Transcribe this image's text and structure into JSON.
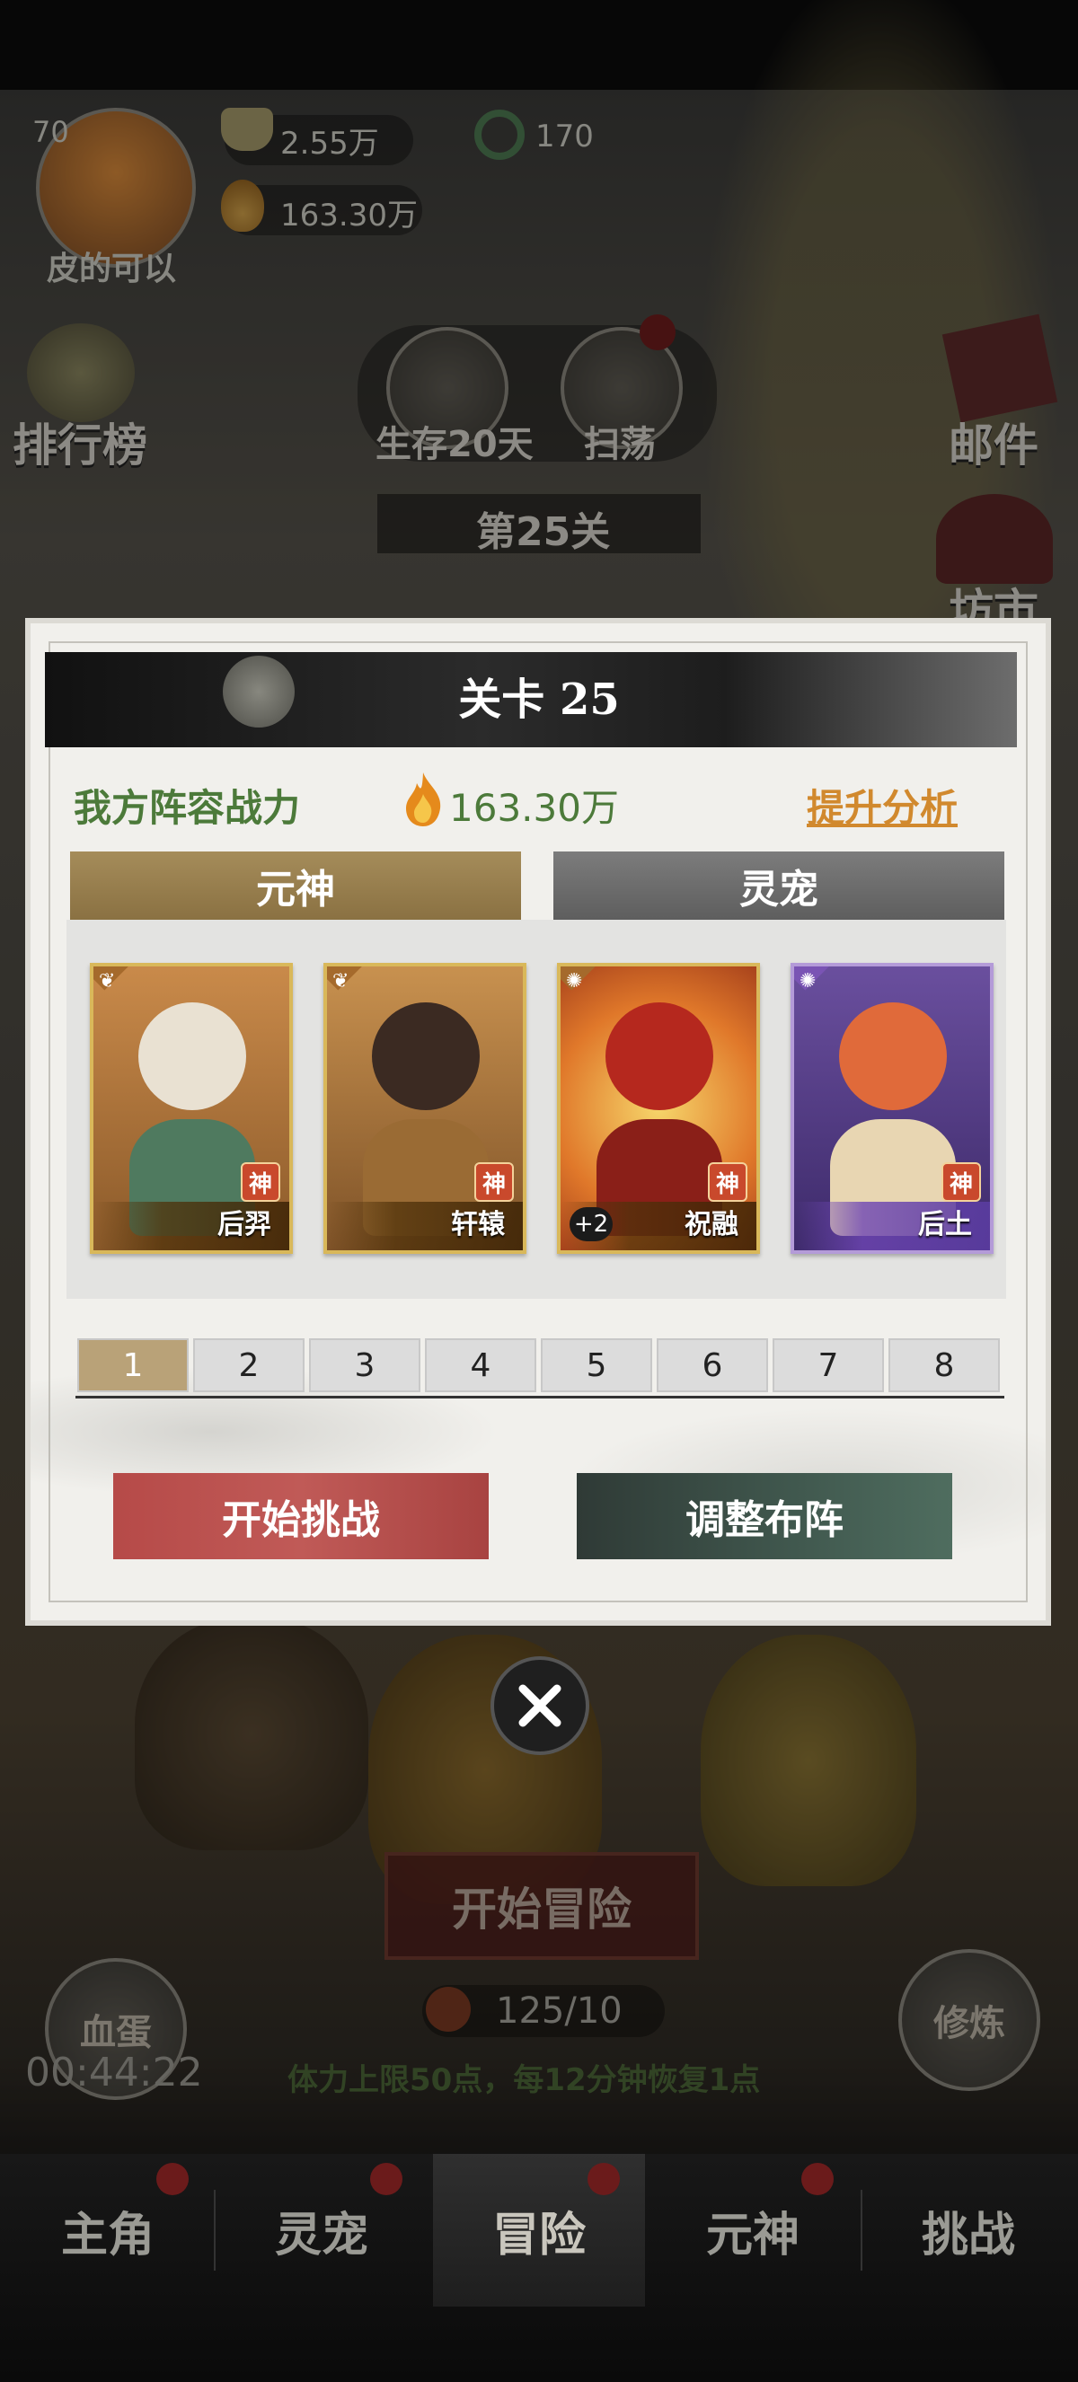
{
  "hud": {
    "level": "70",
    "player_name": "皮的可以",
    "gold": "2.55万",
    "jade": "170",
    "power": "163.30万"
  },
  "scene": {
    "ranking_label": "排行榜",
    "mail_label": "邮件",
    "market_label": "坊市",
    "survive_label": "生存20天",
    "sweep_label": "扫荡",
    "stage_label": "第25关",
    "adventure_button": "开始冒险",
    "blood_egg_label": "血蛋",
    "timer": "00:44:22",
    "practice_label": "修炼",
    "stamina": "125/10",
    "stamina_hint": "体力上限50点，每12分钟恢复1点"
  },
  "tabs": [
    {
      "label": "主角",
      "dot": true
    },
    {
      "label": "灵宠",
      "dot": true
    },
    {
      "label": "冒险",
      "dot": true,
      "active": true
    },
    {
      "label": "元神",
      "dot": true
    },
    {
      "label": "挑战",
      "dot": false
    }
  ],
  "modal": {
    "title": "关卡 25",
    "power_label": "我方阵容战力",
    "power_value": "163.30万",
    "analysis_link": "提升分析",
    "subtabs": [
      "元神",
      "灵宠"
    ],
    "cards": [
      {
        "name": "后羿",
        "badge": "神",
        "plus": ""
      },
      {
        "name": "轩辕",
        "badge": "神",
        "plus": ""
      },
      {
        "name": "祝融",
        "badge": "神",
        "plus": "+2"
      },
      {
        "name": "后土",
        "badge": "神",
        "plus": ""
      }
    ],
    "pages": [
      "1",
      "2",
      "3",
      "4",
      "5",
      "6",
      "7",
      "8"
    ],
    "start_button": "开始挑战",
    "adjust_button": "调整布阵"
  }
}
